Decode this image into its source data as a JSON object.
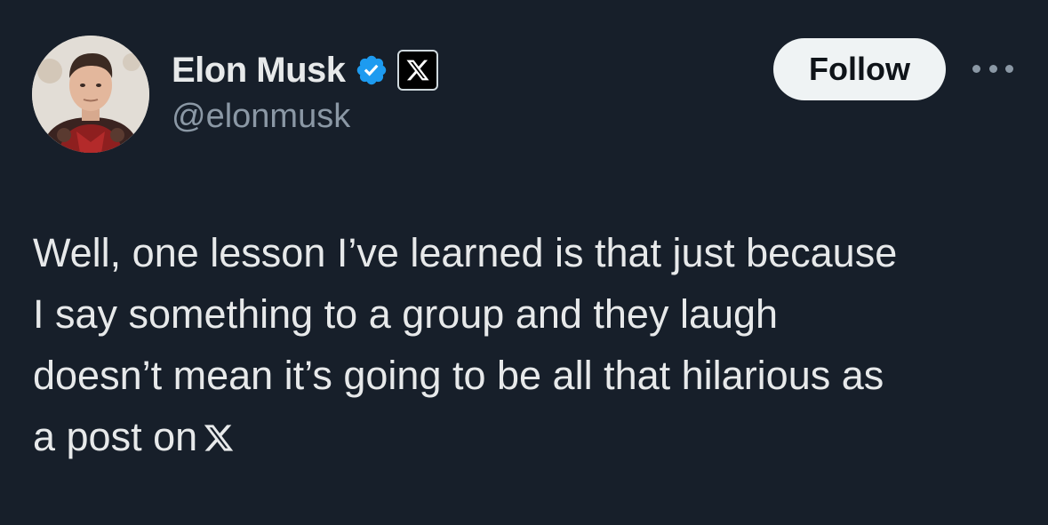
{
  "author": {
    "display_name": "Elon Musk",
    "handle": "@elonmusk",
    "avatar_icon": "profile-photo",
    "verified_icon": "verified-badge-icon",
    "affiliate_icon": "x-logo-icon"
  },
  "actions": {
    "follow_label": "Follow",
    "more_icon": "more-options-icon"
  },
  "tweet": {
    "lines": [
      "Well, one lesson I’ve learned is that just because",
      "I say something to a group and they laugh",
      "doesn’t mean it’s going to be all that hilarious as",
      "a post on"
    ],
    "trailing_icon": "x-logo-icon"
  },
  "colors": {
    "background": "#171f2a",
    "text": "#e7e9ea",
    "secondary_text": "#8b98a5",
    "verified_blue": "#1d9bf0",
    "follow_bg": "#eff3f4"
  }
}
